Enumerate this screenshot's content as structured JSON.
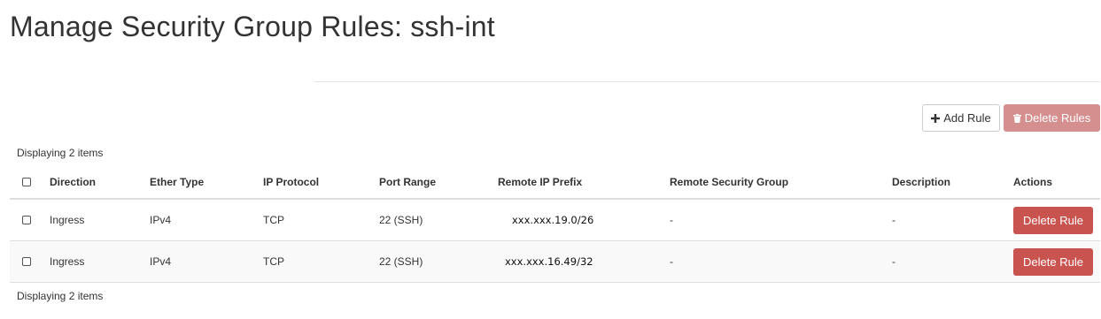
{
  "page": {
    "title": "Manage Security Group Rules: ssh-int"
  },
  "toolbar": {
    "add_rule_label": "Add Rule",
    "delete_rules_label": "Delete Rules",
    "add_icon": "plus-icon",
    "delete_icon": "trash-icon"
  },
  "table": {
    "count_top": "Displaying 2 items",
    "count_bottom": "Displaying 2 items",
    "columns": {
      "direction": "Direction",
      "ether_type": "Ether Type",
      "ip_protocol": "IP Protocol",
      "port_range": "Port Range",
      "remote_ip_prefix": "Remote IP Prefix",
      "remote_security_group": "Remote Security Group",
      "description": "Description",
      "actions": "Actions"
    },
    "rows": [
      {
        "direction": "Ingress",
        "ether_type": "IPv4",
        "ip_protocol": "TCP",
        "port_range": "22 (SSH)",
        "remote_ip_prefix": "xxx.xxx.19.0/26",
        "remote_security_group": "-",
        "description": "-",
        "action_label": "Delete Rule"
      },
      {
        "direction": "Ingress",
        "ether_type": "IPv4",
        "ip_protocol": "TCP",
        "port_range": "22 (SSH)",
        "remote_ip_prefix": "xxx.xxx.16.49/32",
        "remote_security_group": "-",
        "description": "-",
        "action_label": "Delete Rule"
      }
    ]
  },
  "colors": {
    "danger": "#c9534f",
    "danger_disabled": "#d58f8f",
    "border": "#dddddd",
    "text": "#333333"
  }
}
